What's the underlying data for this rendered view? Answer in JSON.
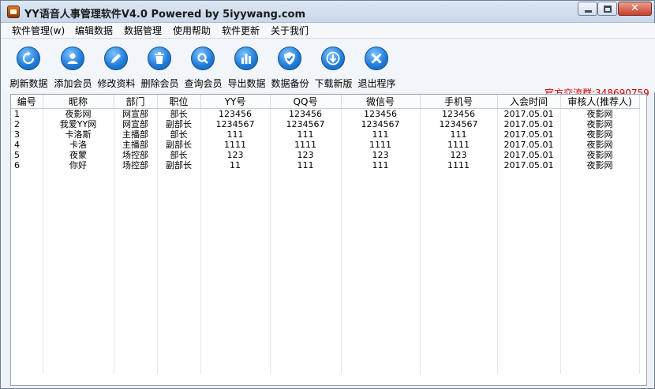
{
  "window": {
    "title": "YY语音人事管理软件V4.0 Powered by 5iyywang.com",
    "buttons": {
      "minimize": "minimize",
      "maximize": "maximize",
      "close": "✕"
    }
  },
  "menu": [
    "软件管理(w)",
    "编辑数据",
    "数据管理",
    "使用帮助",
    "软件更新",
    "关于我们"
  ],
  "toolbar": {
    "buttons": [
      {
        "label": "刷新数据",
        "icon": "refresh-icon"
      },
      {
        "label": "添加会员",
        "icon": "add-user-icon"
      },
      {
        "label": "修改资料",
        "icon": "edit-pencil-icon"
      },
      {
        "label": "删除会员",
        "icon": "trash-icon"
      },
      {
        "label": "查询会员",
        "icon": "search-icon"
      },
      {
        "label": "导出数据",
        "icon": "bar-chart-icon"
      },
      {
        "label": "数据备份",
        "icon": "shield-icon"
      },
      {
        "label": "下载新版",
        "icon": "download-icon"
      },
      {
        "label": "退出程序",
        "icon": "close-icon"
      }
    ],
    "contact_label": "官方交流群:",
    "contact_value": "348690759"
  },
  "table": {
    "columns": [
      "编号",
      "昵称",
      "部门",
      "职位",
      "YY号",
      "QQ号",
      "微信号",
      "手机号",
      "入会时间",
      "审核人(推荐人)"
    ],
    "rows": [
      [
        "1",
        "夜影网",
        "网宣部",
        "部长",
        "123456",
        "123456",
        "123456",
        "123456",
        "2017.05.01",
        "夜影网"
      ],
      [
        "2",
        "我爱YY网",
        "网宣部",
        "副部长",
        "1234567",
        "1234567",
        "1234567",
        "1234567",
        "2017.05.01",
        "夜影网"
      ],
      [
        "3",
        "卡洛斯",
        "主播部",
        "部长",
        "111",
        "111",
        "111",
        "111",
        "2017.05.01",
        "夜影网"
      ],
      [
        "4",
        "卡洛",
        "主播部",
        "副部长",
        "1111",
        "1111",
        "1111",
        "1111",
        "2017.05.01",
        "夜影网"
      ],
      [
        "5",
        "夜蒙",
        "场控部",
        "部长",
        "123",
        "123",
        "123",
        "123",
        "2017.05.01",
        "夜影网"
      ],
      [
        "6",
        "你好",
        "场控部",
        "副部长",
        "11",
        "111",
        "111",
        "1111",
        "2017.05.01",
        "夜影网"
      ]
    ]
  },
  "colors": {
    "accent": "#1f7ad6",
    "contact": "#d40000",
    "title_bar": "#c8d7ea"
  }
}
